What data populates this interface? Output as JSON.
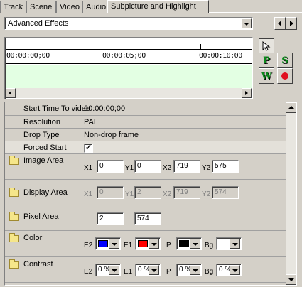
{
  "tabs": [
    "Track",
    "Scene",
    "Video",
    "Audio",
    "Subpicture and Highlight"
  ],
  "active_tab": "Subpicture and Highlight",
  "effects_dropdown": {
    "value": "Advanced Effects"
  },
  "timeline": {
    "labels": [
      "00:00:00;00",
      "00:00:05;00",
      "00:00:10;00"
    ]
  },
  "tools": {
    "pointer": "pointer-icon",
    "p": "P",
    "s": "S",
    "w": "W",
    "record": "record-icon"
  },
  "properties": {
    "start_time": {
      "label": "Start Time To video",
      "value": "00:00:00;00"
    },
    "resolution": {
      "label": "Resolution",
      "value": "PAL"
    },
    "drop_type": {
      "label": "Drop Type",
      "value": "Non-drop frame"
    },
    "forced_start": {
      "label": "Forced Start",
      "check": "✓"
    },
    "image_area": {
      "label": "Image Area",
      "x1": "0",
      "y1": "0",
      "x2": "719",
      "y2": "575"
    },
    "display_area": {
      "label": "Display Area",
      "x1": "0",
      "y1": "2",
      "x2": "719",
      "y2": "574"
    },
    "pixel_area": {
      "label": "Pixel Area",
      "a": "2",
      "b": "574"
    },
    "color": {
      "label": "Color",
      "e2": "#0000ff",
      "e1": "#ff0000",
      "p": "#000000",
      "bg": "#ffffff"
    },
    "contrast": {
      "label": "Contrast",
      "e2": "0 %",
      "e1": "0 %",
      "p": "0 %",
      "bg": "0 %"
    }
  },
  "field_labels": {
    "x1": "X1",
    "y1": "Y1",
    "x2": "X2",
    "y2": "Y2",
    "e2": "E2",
    "e1": "E1",
    "p": "P",
    "bg": "Bg"
  }
}
